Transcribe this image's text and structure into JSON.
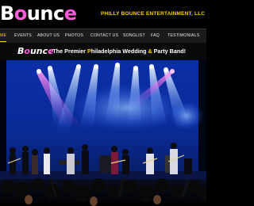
{
  "header": {
    "logo_part1": "B",
    "logo_part2": "o",
    "logo_part3": "unc",
    "logo_part4": "e",
    "company": "PHILLY BOUNCE ENTERTAINMENT, LLC"
  },
  "nav": {
    "items": [
      {
        "label": "ME"
      },
      {
        "label": "EVENTS"
      },
      {
        "label": "ABOUT US"
      },
      {
        "label": "PHOTOS"
      },
      {
        "label": "CONTACT US"
      },
      {
        "label": "SONGLIST"
      },
      {
        "label": "FAQ"
      },
      {
        "label": "TESTIMONIALS"
      }
    ]
  },
  "tagline": {
    "brand_part1": "B",
    "brand_part2": "o",
    "brand_part3": "unc",
    "brand_part4": "e",
    "text_part1": ": The Premier ",
    "text_p": "P",
    "text_part2": "hiladelphia Wedding ",
    "text_amp": "&",
    "text_part3": " Party Band!"
  },
  "photo": {
    "subject": "band-on-stage-photo"
  },
  "colors": {
    "accent_yellow": "#ffd400",
    "accent_pink": "#ff5ad8",
    "nav_bg": "#1b1b1b",
    "stage_blue": "#1a4fd8"
  }
}
